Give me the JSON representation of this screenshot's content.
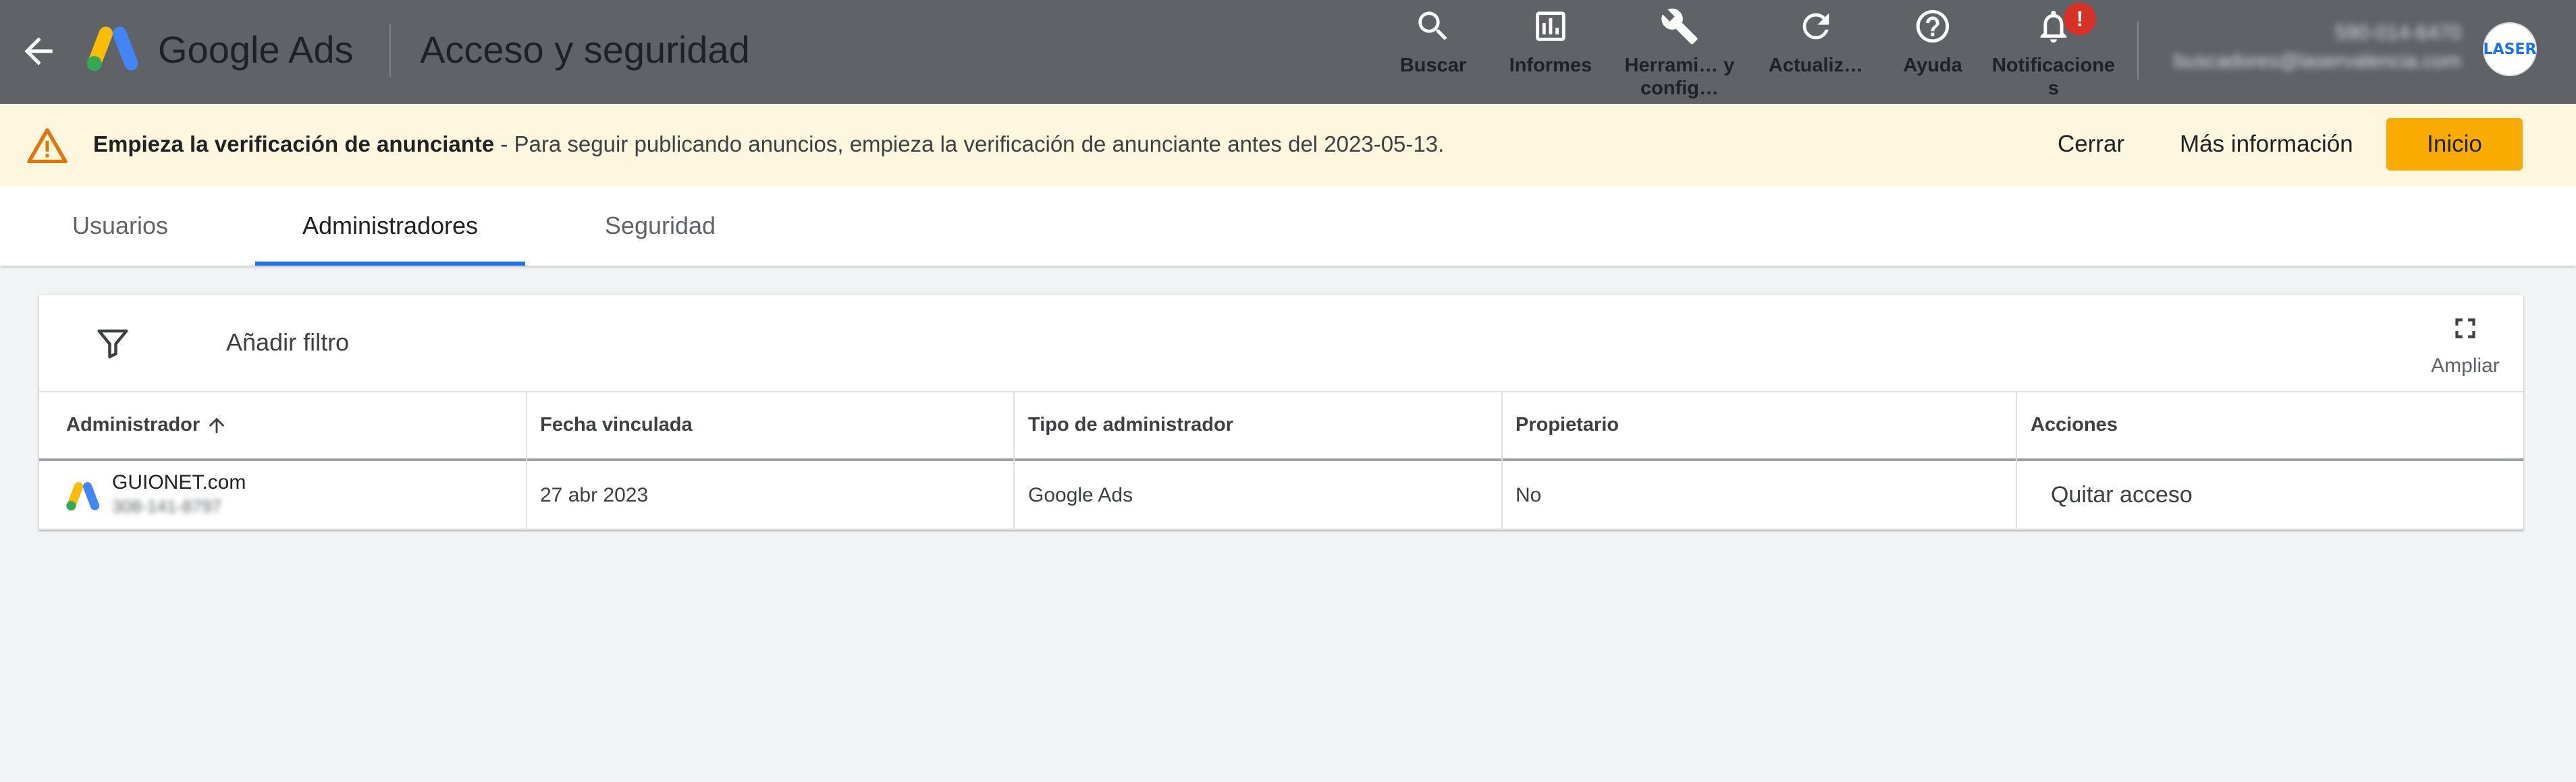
{
  "topbar": {
    "brand": "Google Ads",
    "page_title": "Acceso y seguridad",
    "tools": {
      "search": "Buscar",
      "reports": "Informes",
      "tools": "Herrami… y config…",
      "refresh": "Actualiz…",
      "help": "Ayuda",
      "notifications": "Notificaciones",
      "notification_badge": "!"
    },
    "account": {
      "phone": "590-014-6470",
      "email": "buscadores@laservalencia.com",
      "avatar_text": "LASER"
    }
  },
  "banner": {
    "title": "Empieza la verificación de anunciante",
    "message": " - Para seguir publicando anuncios, empieza la verificación de anunciante antes del 2023-05-13.",
    "close_label": "Cerrar",
    "more_info_label": "Más información",
    "start_label": "Inicio"
  },
  "tabs": [
    {
      "label": "Usuarios",
      "active": false
    },
    {
      "label": "Administradores",
      "active": true
    },
    {
      "label": "Seguridad",
      "active": false
    }
  ],
  "toolbar": {
    "add_filter_label": "Añadir filtro",
    "expand_label": "Ampliar"
  },
  "table": {
    "columns": [
      "Administrador",
      "Fecha vinculada",
      "Tipo de administrador",
      "Propietario",
      "Acciones"
    ],
    "sort_column": "Administrador",
    "sort_direction": "ascending",
    "rows": [
      {
        "name": "GUIONET.com",
        "account_id": "308-141-8797",
        "linked_date": "27 abr 2023",
        "manager_type": "Google Ads",
        "owner": "No",
        "action": "Quitar acceso"
      }
    ]
  },
  "colors": {
    "topbar": "#5f6368",
    "banner": "#fef7e0",
    "accent_blue": "#1a73e8",
    "start_button": "#f9ab00",
    "warning_icon": "#e37400",
    "badge": "#d93025"
  }
}
